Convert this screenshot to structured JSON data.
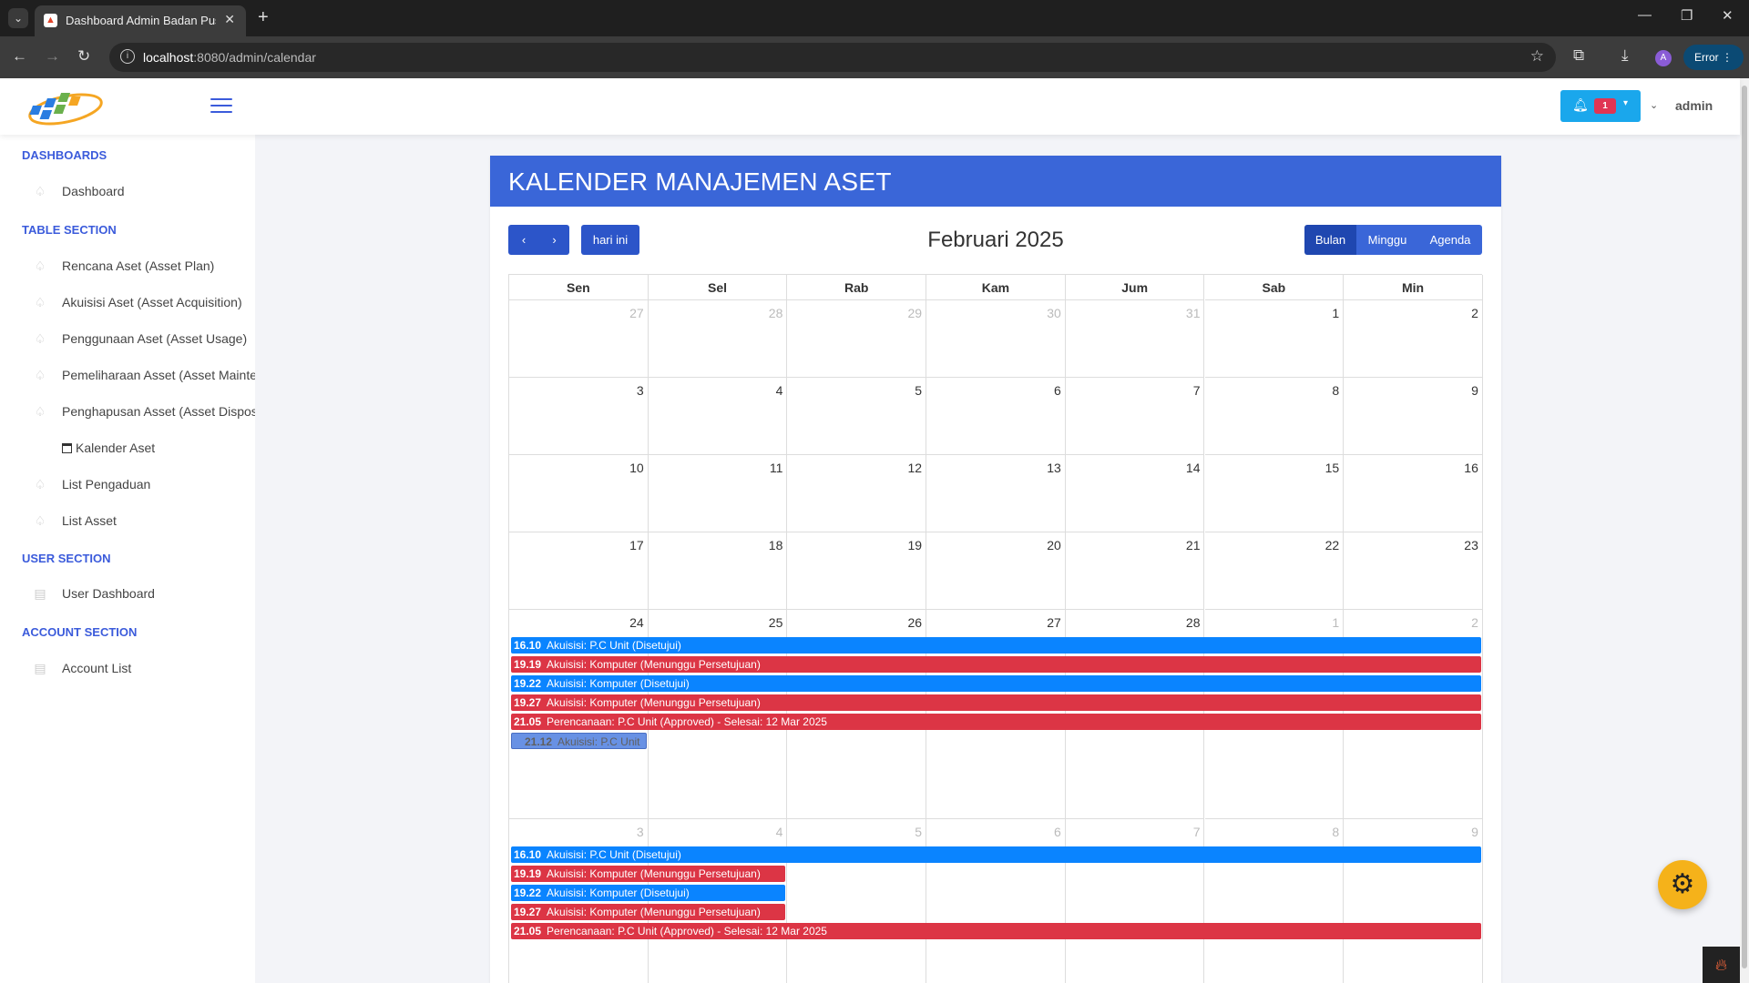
{
  "browser": {
    "tab_title": "Dashboard Admin Badan Pusat",
    "url_host": "localhost",
    "url_rest": ":8080/admin/calendar",
    "profile_initial": "A",
    "error_label": "Error"
  },
  "header": {
    "notification_count": "1",
    "username": "admin"
  },
  "sidebar": {
    "sections": [
      {
        "title": "DASHBOARDS",
        "items": [
          "Dashboard"
        ]
      },
      {
        "title": "TABLE SECTION",
        "items": [
          "Rencana Aset (Asset Plan)",
          "Akuisisi Aset (Asset Acquisition)",
          "Penggunaan Aset (Asset Usage)",
          "Pemeliharaan Asset (Asset Maintenance)",
          "Penghapusan Asset (Asset Disposal)",
          "Kalender Aset",
          "List Pengaduan",
          "List Asset"
        ]
      },
      {
        "title": "USER SECTION",
        "items": [
          "User Dashboard"
        ]
      },
      {
        "title": "ACCOUNT SECTION",
        "items": [
          "Account List"
        ]
      }
    ]
  },
  "calendar": {
    "card_title": "KALENDER MANAJEMEN ASET",
    "today_label": "hari ini",
    "title": "Februari 2025",
    "views": [
      "Bulan",
      "Minggu",
      "Agenda"
    ],
    "active_view": "Bulan",
    "weekdays": [
      "Sen",
      "Sel",
      "Rab",
      "Kam",
      "Jum",
      "Sab",
      "Min"
    ],
    "weeks": [
      [
        [
          "27",
          true
        ],
        [
          "28",
          true
        ],
        [
          "29",
          true
        ],
        [
          "30",
          true
        ],
        [
          "31",
          true
        ],
        [
          "1",
          false
        ],
        [
          "2",
          false
        ]
      ],
      [
        [
          "3",
          false
        ],
        [
          "4",
          false
        ],
        [
          "5",
          false
        ],
        [
          "6",
          false
        ],
        [
          "7",
          false
        ],
        [
          "8",
          false
        ],
        [
          "9",
          false
        ]
      ],
      [
        [
          "10",
          false
        ],
        [
          "11",
          false
        ],
        [
          "12",
          false
        ],
        [
          "13",
          false
        ],
        [
          "14",
          false
        ],
        [
          "15",
          false
        ],
        [
          "16",
          false
        ]
      ],
      [
        [
          "17",
          false
        ],
        [
          "18",
          false
        ],
        [
          "19",
          false
        ],
        [
          "20",
          false
        ],
        [
          "21",
          false
        ],
        [
          "22",
          false
        ],
        [
          "23",
          false
        ]
      ],
      [
        [
          "24",
          false
        ],
        [
          "25",
          false
        ],
        [
          "26",
          false
        ],
        [
          "27",
          false
        ],
        [
          "28",
          false
        ],
        [
          "1",
          true
        ],
        [
          "2",
          true
        ]
      ],
      [
        [
          "3",
          true
        ],
        [
          "4",
          true
        ],
        [
          "5",
          true
        ],
        [
          "6",
          true
        ],
        [
          "7",
          true
        ],
        [
          "8",
          true
        ],
        [
          "9",
          true
        ]
      ]
    ],
    "events_week5": [
      {
        "time": "16.10",
        "title": "Akuisisi: P.C Unit (Disetujui)",
        "color": "blue",
        "span": 7
      },
      {
        "time": "19.19",
        "title": "Akuisisi: Komputer (Menunggu Persetujuan)",
        "color": "red",
        "span": 7
      },
      {
        "time": "19.22",
        "title": "Akuisisi: Komputer (Disetujui)",
        "color": "blue",
        "span": 7
      },
      {
        "time": "19.27",
        "title": "Akuisisi: Komputer (Menunggu Persetujuan)",
        "color": "red",
        "span": 7
      },
      {
        "time": "21.05",
        "title": "Perencanaan: P.C Unit (Approved) - Selesai: 12 Mar 2025",
        "color": "red",
        "span": 7
      },
      {
        "time": "21.12",
        "title": "Akuisisi: P.C Unit",
        "color": "drag",
        "span": 1
      }
    ],
    "events_week6": [
      {
        "time": "16.10",
        "title": "Akuisisi: P.C Unit (Disetujui)",
        "color": "blue",
        "span": 7
      },
      {
        "time": "19.19",
        "title": "Akuisisi: Komputer (Menunggu Persetujuan)",
        "color": "red",
        "span": 2
      },
      {
        "time": "19.22",
        "title": "Akuisisi: Komputer (Disetujui)",
        "color": "blue",
        "span": 2
      },
      {
        "time": "19.27",
        "title": "Akuisisi: Komputer (Menunggu Persetujuan)",
        "color": "red",
        "span": 2
      },
      {
        "time": "21.05",
        "title": "Perencanaan: P.C Unit (Approved) - Selesai: 12 Mar 2025",
        "color": "red",
        "span": 7
      }
    ]
  },
  "colors": {
    "primary": "#3a66d8",
    "event_blue": "#0a84ff",
    "event_red": "#dc3545",
    "fab": "#f5b21a"
  }
}
